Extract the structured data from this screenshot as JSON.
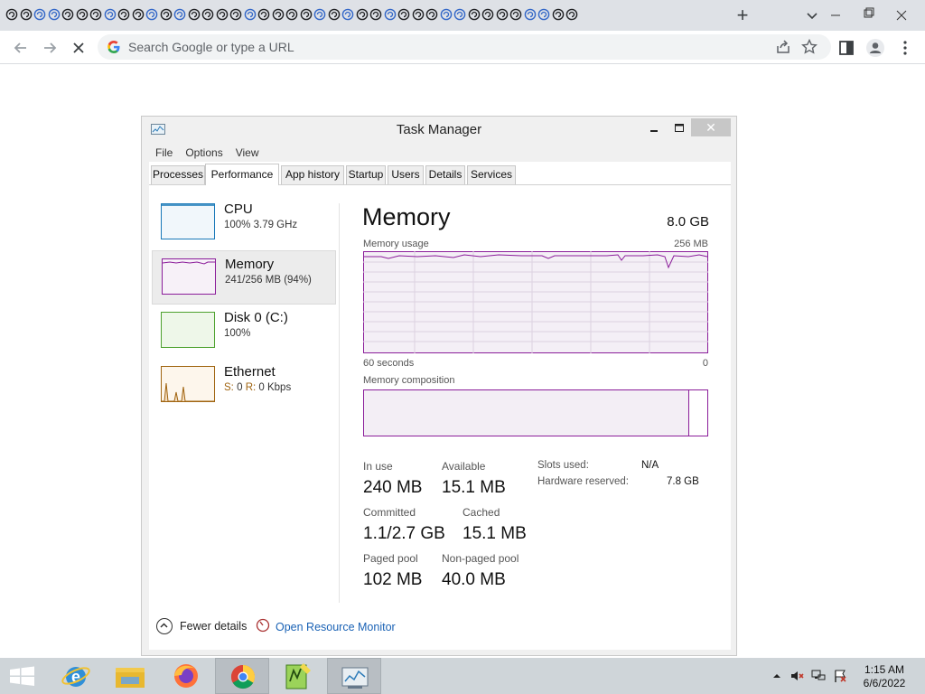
{
  "browser": {
    "tab_icon_count": 41,
    "new_tab_label": "+",
    "omnibox_placeholder": "Search Google or type a URL"
  },
  "task_manager": {
    "title": "Task Manager",
    "close_label": "✕",
    "menu": [
      "File",
      "Options",
      "View"
    ],
    "tabs": [
      "Processes",
      "Performance",
      "App history",
      "Startup",
      "Users",
      "Details",
      "Services"
    ],
    "active_tab": "Performance",
    "sidebar": [
      {
        "name": "CPU",
        "sub": "100%  3.79 GHz",
        "color": "#1878b8"
      },
      {
        "name": "Memory",
        "sub": "241/256 MB (94%)",
        "color": "#8b1d9a"
      },
      {
        "name": "Disk 0 (C:)",
        "sub": "100%",
        "color": "#4da12e"
      },
      {
        "name": "Ethernet",
        "sub_label_s": "S:",
        "sub_val_s": "0",
        "sub_label_r": "R:",
        "sub_val_r": "0 Kbps",
        "color": "#a06410"
      }
    ],
    "memory": {
      "title": "Memory",
      "total": "8.0 GB",
      "usage_label": "Memory usage",
      "usage_max": "256 MB",
      "time_left": "60 seconds",
      "time_right": "0",
      "composition_label": "Memory composition",
      "stats": {
        "in_use_label": "In use",
        "in_use": "240 MB",
        "available_label": "Available",
        "available": "15.1 MB",
        "committed_label": "Committed",
        "committed": "1.1/2.7 GB",
        "cached_label": "Cached",
        "cached": "15.1 MB",
        "paged_label": "Paged pool",
        "paged": "102 MB",
        "nonpaged_label": "Non-paged pool",
        "nonpaged": "40.0 MB",
        "slots_label": "Slots used:",
        "slots": "N/A",
        "hw_label": "Hardware reserved:",
        "hw": "7.8 GB"
      }
    },
    "footer": {
      "fewer_details": "Fewer details",
      "resource_monitor": "Open Resource Monitor"
    }
  },
  "taskbar": {
    "time": "1:15 AM",
    "date": "6/6/2022",
    "items": [
      "windows-start",
      "internet-explorer",
      "file-explorer",
      "firefox",
      "chrome",
      "notepad-plus-plus",
      "task-manager"
    ]
  }
}
